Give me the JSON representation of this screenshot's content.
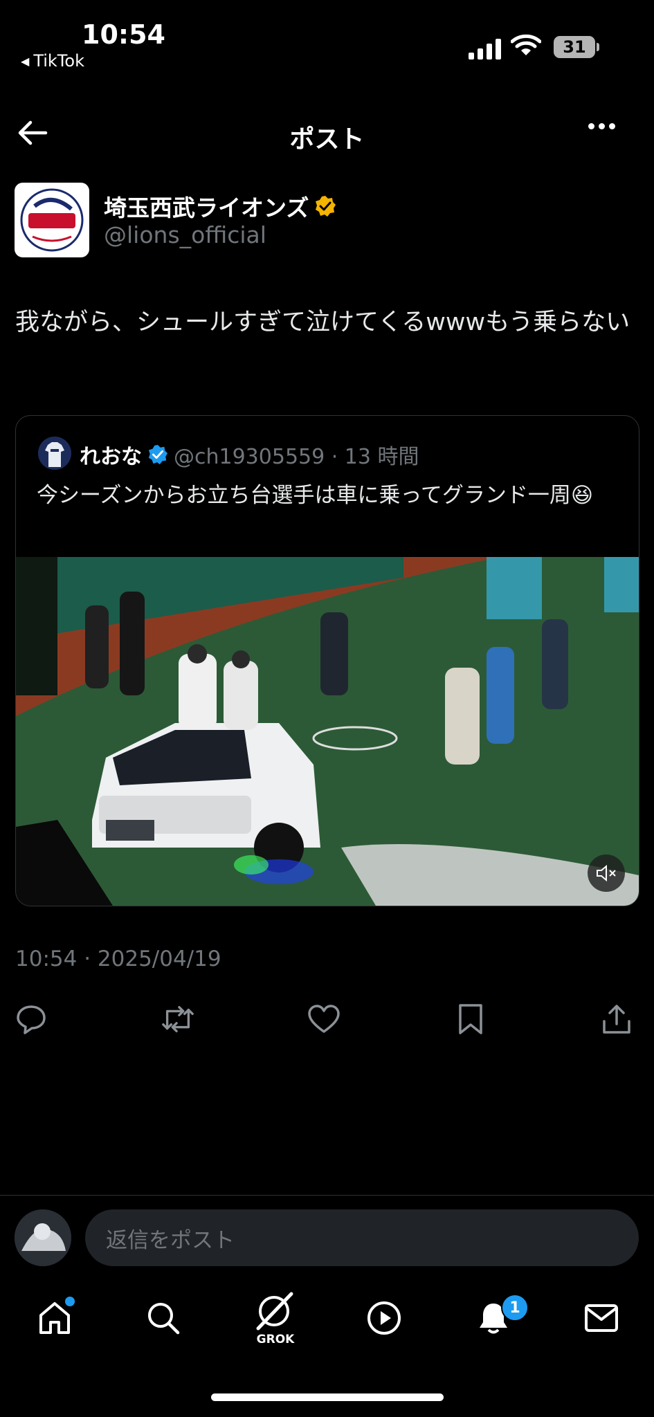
{
  "status_bar": {
    "time": "10:54",
    "back_app": "TikTok",
    "battery": "31"
  },
  "header": {
    "title": "ポスト"
  },
  "post": {
    "author_name": "埼玉西武ライオンズ",
    "author_handle": "@lions_official",
    "text": "我ながら、シュールすぎて泣けてくるwwwもう乗らない",
    "timestamp": "10:54 · 2025/04/19"
  },
  "quote": {
    "name": "れおな",
    "meta": "@ch19305559 · 13 時間",
    "text": "今シーズンからお立ち台選手は車に乗ってグランド一周😆"
  },
  "reply": {
    "placeholder": "返信をポスト"
  },
  "nav": {
    "grok_label": "GROK",
    "notification_count": "1"
  },
  "colors": {
    "accent": "#1d9bf0",
    "verified": "#f4b400",
    "background": "#000000"
  }
}
